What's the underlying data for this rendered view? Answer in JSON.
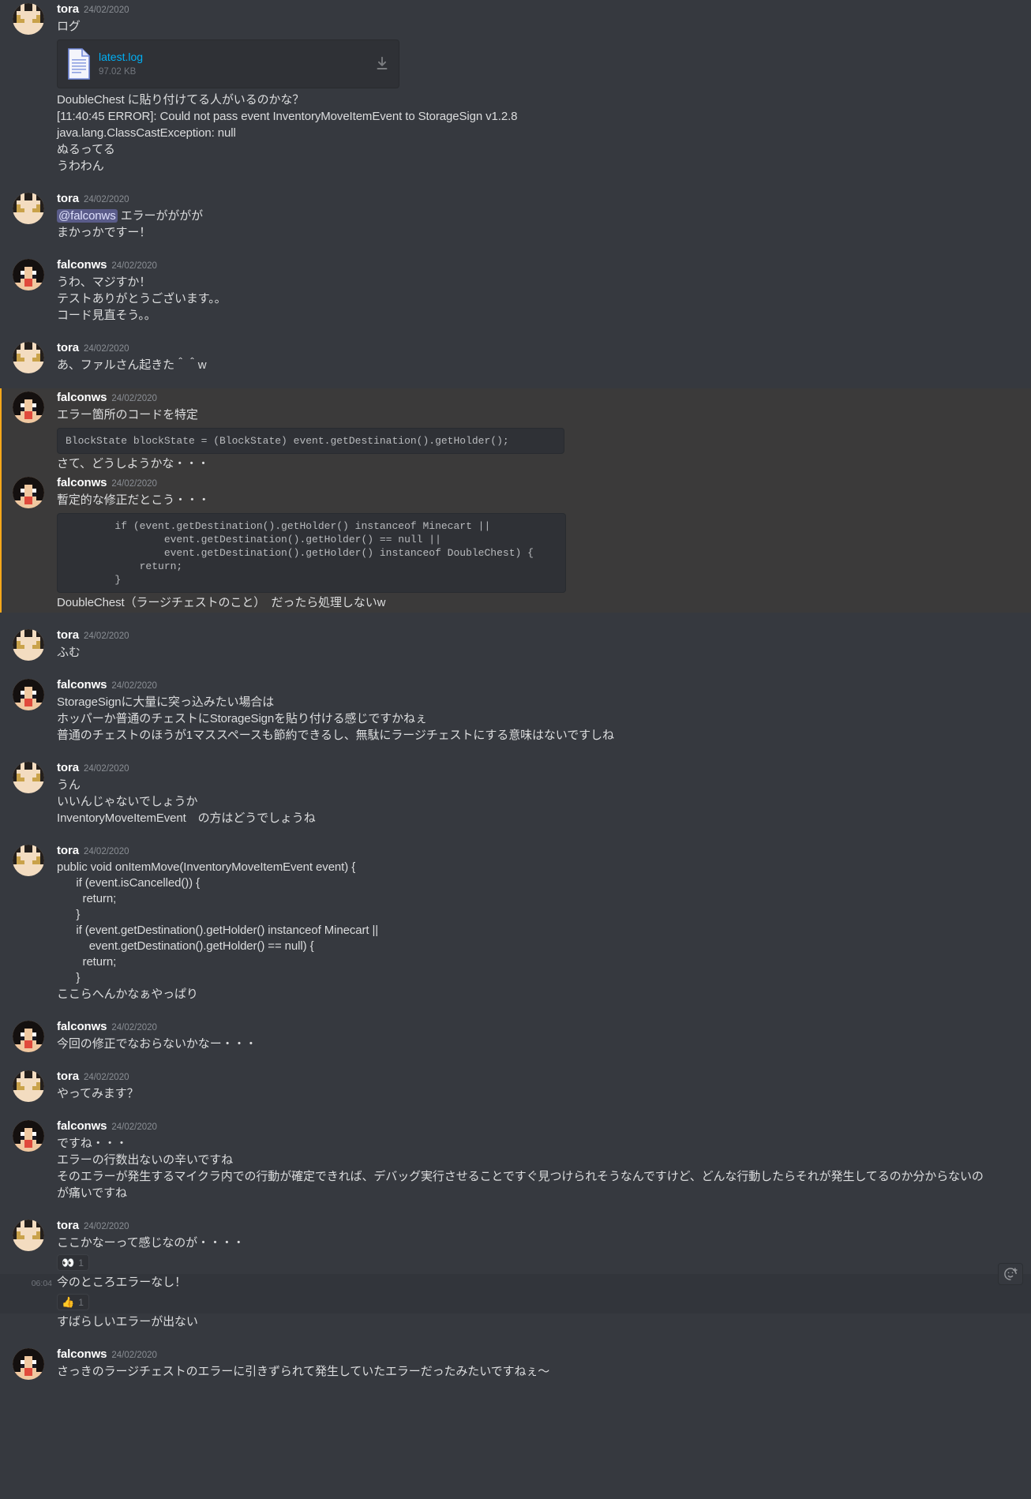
{
  "theme": {
    "bg": "#36393f",
    "text": "#dcddde",
    "muted": "#72767d",
    "link": "#00aff4",
    "mention_bg": "#5a5c8a",
    "mention_row_bg": "#3b3a3a",
    "mention_bar": "#faa81a",
    "code_bg": "#2f3136"
  },
  "users": {
    "tora": {
      "name": "tora",
      "avatar": "minecraft-head-tora"
    },
    "falconws": {
      "name": "falconws",
      "avatar": "minecraft-head-falconws"
    }
  },
  "messages": [
    {
      "id": "m1",
      "author": "tora",
      "timestamp": "24/02/2020",
      "lines": [
        "ログ"
      ],
      "attachment": {
        "filename": "latest.log",
        "filesize": "97.02 KB",
        "icon": "file-document-icon",
        "download_icon": "download-icon"
      },
      "lines_after": [
        "DoubleChest に貼り付けてる人がいるのかな？",
        "[11:40:45 ERROR]: Could not pass event InventoryMoveItemEvent to StorageSign v1.2.8",
        "java.lang.ClassCastException: null",
        "ぬるってる",
        "うわわん"
      ]
    },
    {
      "id": "m2",
      "author": "tora",
      "timestamp": "24/02/2020",
      "mention_chip": "@falconws",
      "mention_tail": " エラーがががが",
      "lines": [
        "まかっかですー！"
      ]
    },
    {
      "id": "m3",
      "author": "falconws",
      "timestamp": "24/02/2020",
      "lines": [
        "うわ、マジすか！",
        "テストありがとうございます。。",
        "コード見直そう。。"
      ]
    },
    {
      "id": "m4",
      "author": "tora",
      "timestamp": "24/02/2020",
      "lines": [
        "あ、ファルさん起きた＾＾w"
      ]
    },
    {
      "id": "m5",
      "author": "falconws",
      "timestamp": "24/02/2020",
      "highlighted": true,
      "lines": [
        "エラー箇所のコードを特定"
      ],
      "code": "BlockState blockState = (BlockState) event.getDestination().getHolder();",
      "lines_after": [
        "さて、どうしようかな・・・"
      ]
    },
    {
      "id": "m6",
      "author": "falconws",
      "timestamp": "24/02/2020",
      "highlighted": true,
      "lines": [
        "暫定的な修正だとこう・・・"
      ],
      "code": "        if (event.getDestination().getHolder() instanceof Minecart ||\n                event.getDestination().getHolder() == null ||\n                event.getDestination().getHolder() instanceof DoubleChest) {\n            return;\n        }",
      "lines_after": [
        "DoubleChest（ラージチェストのこと）　だったら処理しないw"
      ]
    },
    {
      "id": "m7",
      "author": "tora",
      "timestamp": "24/02/2020",
      "lines": [
        "ふむ"
      ]
    },
    {
      "id": "m8",
      "author": "falconws",
      "timestamp": "24/02/2020",
      "lines": [
        "StorageSignに大量に突っ込みたい場合は",
        "ホッパーか普通のチェストにStorageSignを貼り付ける感じですかねぇ",
        "普通のチェストのほうが1マススペースも節約できるし、無駄にラージチェストにする意味はないですしね"
      ]
    },
    {
      "id": "m9",
      "author": "tora",
      "timestamp": "24/02/2020",
      "lines": [
        "うん",
        "いいんじゃないでしょうか",
        "InventoryMoveItemEvent　の方はどうでしょうね"
      ]
    },
    {
      "id": "m10",
      "author": "tora",
      "timestamp": "24/02/2020",
      "lines": [
        "public void onItemMove(InventoryMoveItemEvent event) {",
        "      if (event.isCancelled()) {",
        "        return;",
        "      }",
        "      if (event.getDestination().getHolder() instanceof Minecart ||",
        "          event.getDestination().getHolder() == null) {",
        "        return;",
        "      }",
        "ここらへんかなぁやっぱり"
      ]
    },
    {
      "id": "m11",
      "author": "falconws",
      "timestamp": "24/02/2020",
      "lines": [
        "今回の修正でなおらないかなー・・・"
      ]
    },
    {
      "id": "m12",
      "author": "tora",
      "timestamp": "24/02/2020",
      "lines": [
        "やってみます？"
      ]
    },
    {
      "id": "m13",
      "author": "falconws",
      "timestamp": "24/02/2020",
      "lines": [
        "ですね・・・",
        "エラーの行数出ないの辛いですね",
        "そのエラーが発生するマイクラ内での行動が確定できれば、デバッグ実行させることですぐ見つけられそうなんですけど、どんな行動したらそれが発生してるのか分からないのが痛いですね"
      ]
    },
    {
      "id": "m14",
      "author": "tora",
      "timestamp": "24/02/2020",
      "lines": [
        "ここかなーって感じなのが・・・・"
      ],
      "reactions": [
        {
          "emoji": "👀",
          "name": "eyes-reaction",
          "count": "1"
        }
      ]
    },
    {
      "id": "m15",
      "author": "tora",
      "grouped": true,
      "hovered": true,
      "hover_timestamp": "06:04",
      "lines": [
        "今のところエラーなし！"
      ],
      "reactions": [
        {
          "emoji": "👍",
          "name": "thumbsup-reaction",
          "count": "1"
        }
      ],
      "toolbar": {
        "add_reaction_icon": "add-reaction-icon"
      }
    },
    {
      "id": "m16",
      "author": "tora",
      "grouped": true,
      "lines": [
        "すばらしいエラーが出ない"
      ]
    },
    {
      "id": "m17",
      "author": "falconws",
      "timestamp": "24/02/2020",
      "lines": [
        "さっきのラージチェストのエラーに引きずられて発生していたエラーだったみたいですねぇ～"
      ]
    }
  ]
}
